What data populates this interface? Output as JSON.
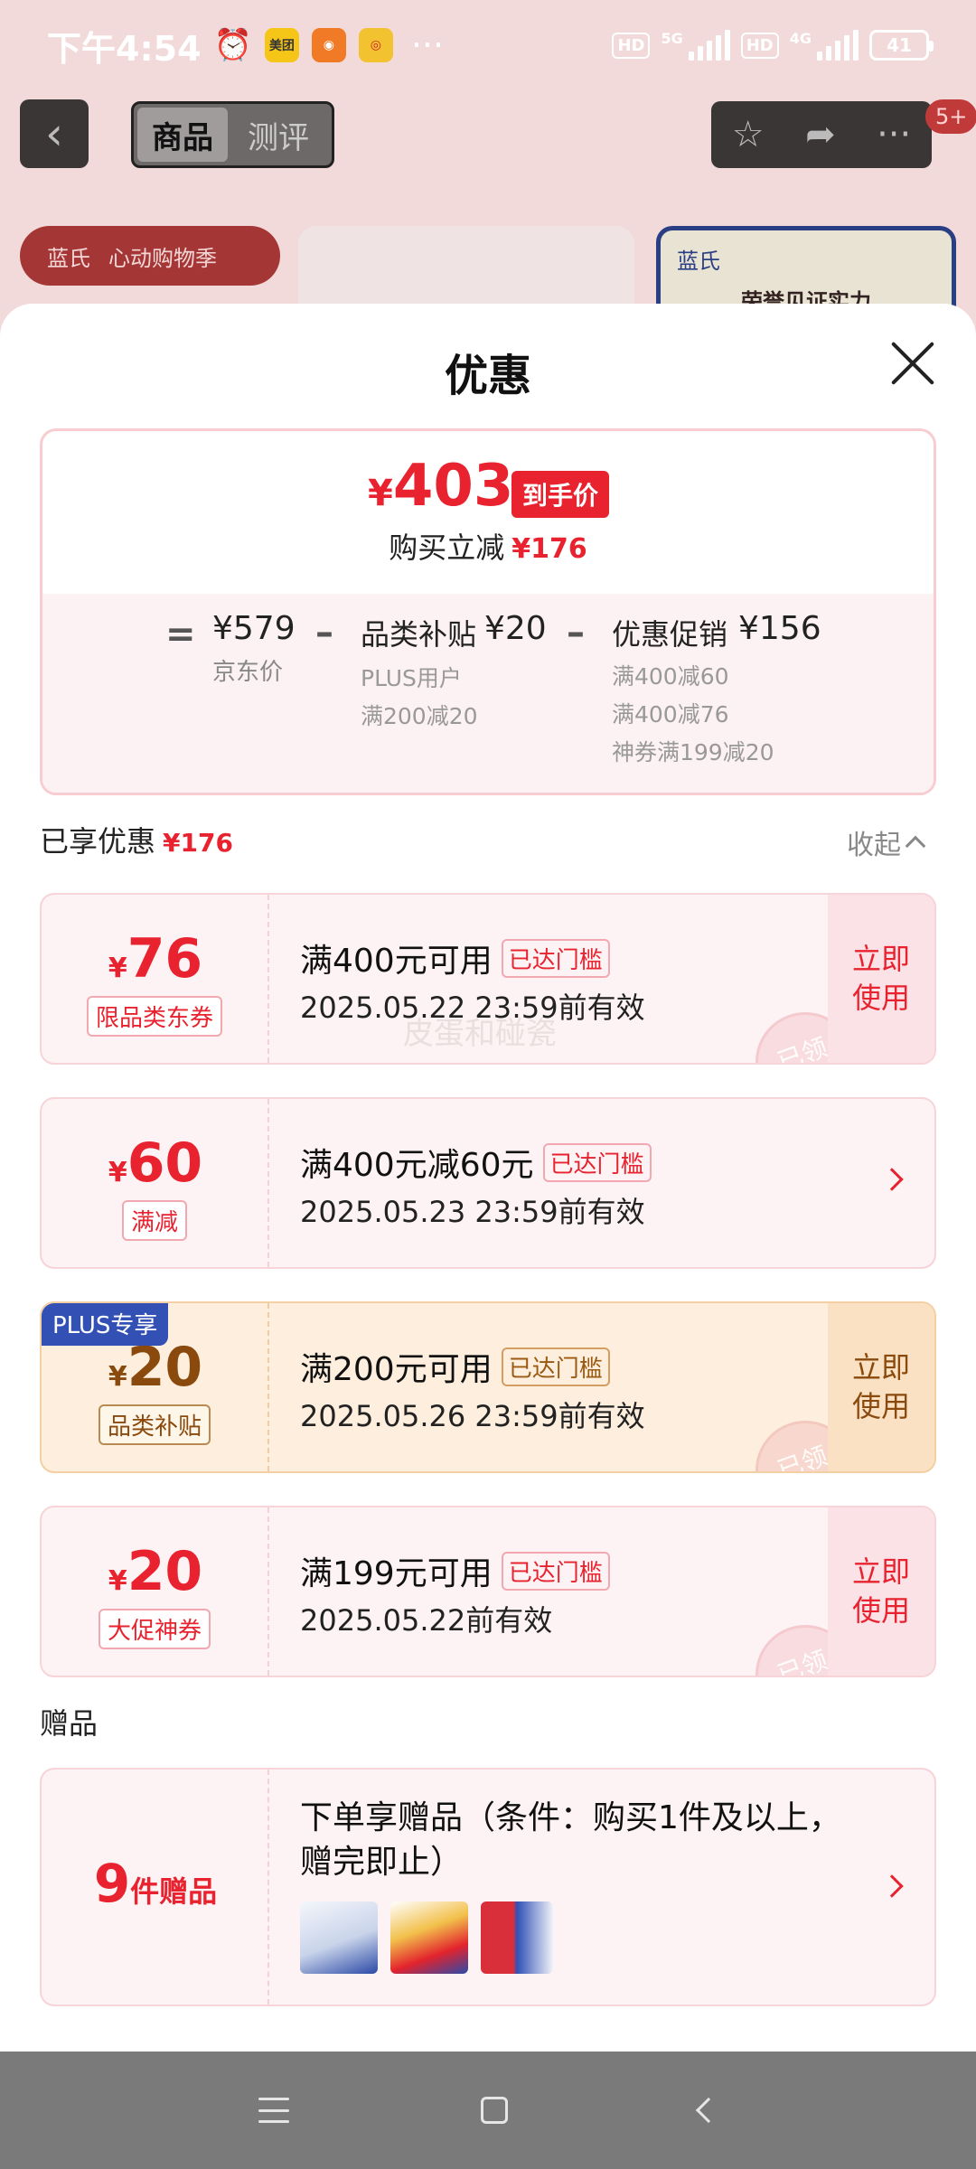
{
  "status_bar": {
    "time": "下午4:54",
    "net1": "5G",
    "net2": "4G",
    "hd": "HD",
    "battery": "41",
    "app_meituan": "美团"
  },
  "background": {
    "tab_goods": "商品",
    "tab_review": "测评",
    "badge": "5+",
    "banner_brand": "蓝氏",
    "banner_text": "心动购物季",
    "card_brand": "蓝氏",
    "card_text": "荣誉见证实力"
  },
  "sheet": {
    "title": "优惠",
    "summary": {
      "currency": "¥",
      "final_price": "403",
      "final_tag": "到手价",
      "save_label": "购买立减",
      "save_amount": "¥176",
      "equals": "=",
      "jd_price": "¥579",
      "jd_label": "京东价",
      "minus": "–",
      "subsidy_title": "品类补贴",
      "subsidy_amount": "¥20",
      "subsidy_lines": [
        "PLUS用户",
        "满200减20"
      ],
      "promo_title": "优惠促销",
      "promo_amount": "¥156",
      "promo_lines": [
        "满400减60",
        "满400减76",
        "神券满199减20"
      ]
    },
    "enjoyed_label": "已享优惠",
    "enjoyed_amount": "¥176",
    "collapse_label": "收起",
    "coupons": [
      {
        "currency": "¥",
        "amount": "76",
        "label": "限品类东券",
        "title": "满400元可用",
        "status": "已达门槛",
        "date": "2025.05.22 23:59前有效",
        "action": "立即\n使用",
        "stamp": "已领"
      },
      {
        "currency": "¥",
        "amount": "60",
        "label": "满减",
        "title": "满400元减60元",
        "status": "已达门槛",
        "date": "2025.05.23 23:59前有效"
      },
      {
        "currency": "¥",
        "amount": "20",
        "label": "品类补贴",
        "plus_tag": "PLUS专享",
        "title": "满200元可用",
        "status": "已达门槛",
        "date": "2025.05.26 23:59前有效",
        "action": "立即\n使用",
        "stamp": "已领"
      },
      {
        "currency": "¥",
        "amount": "20",
        "label": "大促神券",
        "title": "满199元可用",
        "status": "已达门槛",
        "date": "2025.05.22前有效",
        "action": "立即\n使用",
        "stamp": "已领"
      }
    ],
    "watermark": "皮蛋和碰瓷",
    "gifts": {
      "header": "赠品",
      "count": "9",
      "count_unit": "件赠品",
      "description": "下单享赠品（条件：购买1件及以上，赠完即止）"
    }
  },
  "colors": {
    "accent_red": "#e8232f",
    "plus_blue": "#3350b4",
    "gold_text": "#8a4a0d"
  }
}
